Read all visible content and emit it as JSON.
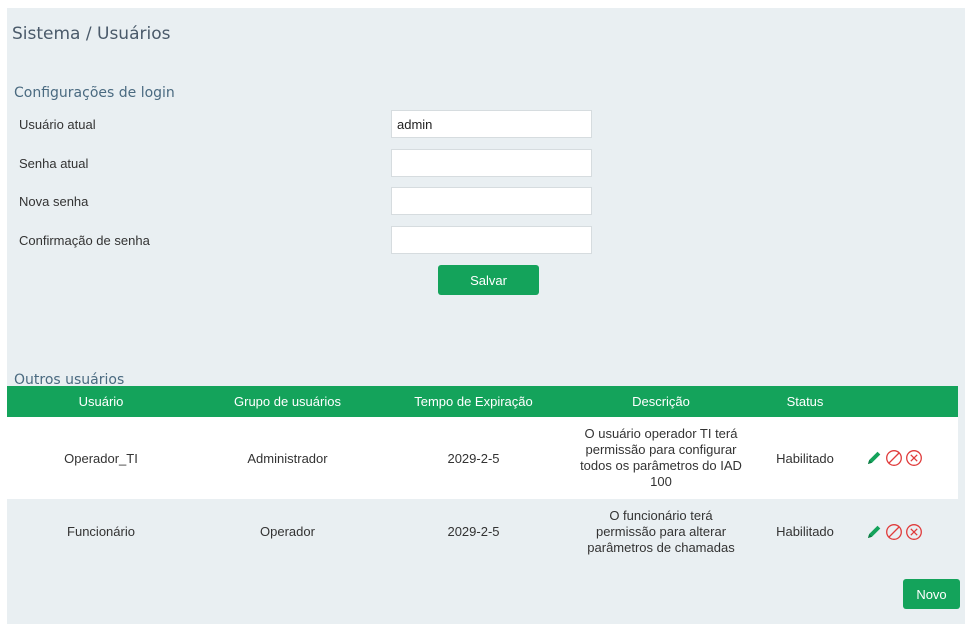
{
  "breadcrumb": "Sistema / Usuários",
  "login_section": {
    "title": "Configurações de login",
    "fields": [
      {
        "label": "Usuário atual",
        "value": "admin"
      },
      {
        "label": "Senha atual",
        "value": ""
      },
      {
        "label": "Nova senha",
        "value": ""
      },
      {
        "label": "Confirmação de senha",
        "value": ""
      }
    ],
    "save_label": "Salvar"
  },
  "others_section": {
    "title": "Outros usuários",
    "columns": [
      "Usuário",
      "Grupo de usuários",
      "Tempo de Expiração",
      "Descrição",
      "Status"
    ],
    "rows": [
      {
        "user": "Operador_TI",
        "group": "Administrador",
        "expiration": "2029-2-5",
        "description": "O usuário operador TI terá permissão para configurar todos os parâmetros do IAD 100",
        "status": "Habilitado"
      },
      {
        "user": "Funcionário",
        "group": "Operador",
        "expiration": "2029-2-5",
        "description": "O funcionário terá permissão para alterar parâmetros de chamadas",
        "status": "Habilitado"
      }
    ],
    "new_label": "Novo"
  },
  "icons": {
    "edit": "pencil-icon",
    "disable": "prohibit-icon",
    "delete": "circle-x-icon"
  },
  "colors": {
    "accent": "#14a35b",
    "panel": "#e9eff2",
    "delete": "#e03b3b"
  }
}
